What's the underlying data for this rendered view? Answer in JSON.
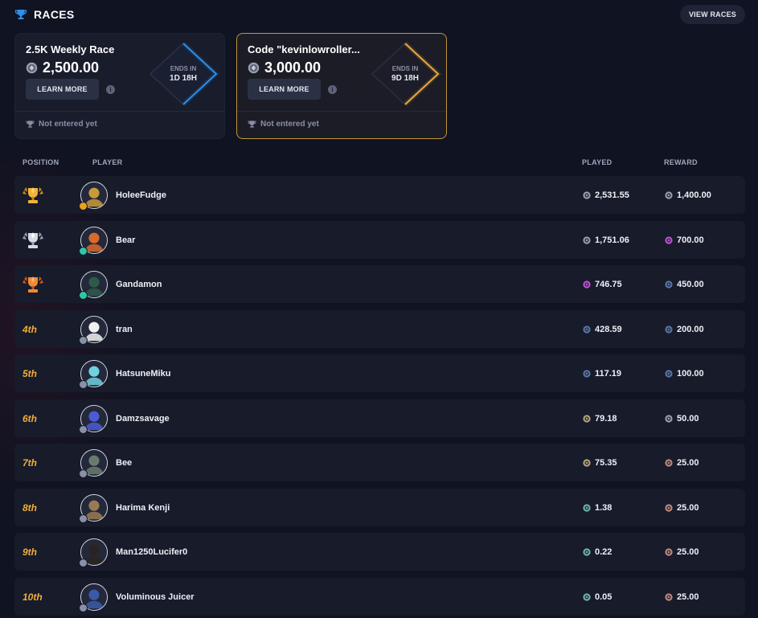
{
  "header": {
    "title": "RACES",
    "view_button": "VIEW RACES"
  },
  "races": [
    {
      "name": "2.5K Weekly Race",
      "amount": "2,500.00",
      "learn_more": "LEARN MORE",
      "ends_label": "ENDS IN",
      "ends_value": "1D 18H",
      "status": "Not entered yet",
      "accent": "#2a8fe8"
    },
    {
      "name": "Code \"kevinlowroller...",
      "amount": "3,000.00",
      "learn_more": "LEARN MORE",
      "ends_label": "ENDS IN",
      "ends_value": "9D 18H",
      "status": "Not entered yet",
      "accent": "#e9a93a"
    }
  ],
  "columns": {
    "position": "POSITION",
    "player": "PLAYER",
    "played": "PLAYED",
    "reward": "REWARD"
  },
  "leaderboard": [
    {
      "position": "",
      "trophy": "gold",
      "name": "HoleeFudge",
      "played": "2,531.55",
      "played_coin": "#9aa0ad",
      "reward": "1,400.00",
      "reward_coin": "#9aa0ad",
      "badge": "#e8a21c",
      "avatar_color": "#c99a3a"
    },
    {
      "position": "",
      "trophy": "silver",
      "name": "Bear",
      "played": "1,751.06",
      "played_coin": "#9aa0ad",
      "reward": "700.00",
      "reward_coin": "#c34fd8",
      "badge": "#2fc7a4",
      "avatar_color": "#d86a2c"
    },
    {
      "position": "",
      "trophy": "bronze",
      "name": "Gandamon",
      "played": "746.75",
      "played_coin": "#c34fd8",
      "reward": "450.00",
      "reward_coin": "#5876a8",
      "badge": "#2fc7a4",
      "avatar_color": "#2e5a4a"
    },
    {
      "position": "4th",
      "trophy": "",
      "name": "tran",
      "played": "428.59",
      "played_coin": "#5876a8",
      "reward": "200.00",
      "reward_coin": "#5876a8",
      "badge": "#8a90a6",
      "avatar_color": "#f2f2f2"
    },
    {
      "position": "5th",
      "trophy": "",
      "name": "HatsuneMiku",
      "played": "117.19",
      "played_coin": "#5876a8",
      "reward": "100.00",
      "reward_coin": "#5876a8",
      "badge": "#8a90a6",
      "avatar_color": "#6fd0e2"
    },
    {
      "position": "6th",
      "trophy": "",
      "name": "Damzsavage",
      "played": "79.18",
      "played_coin": "#b9a57a",
      "reward": "50.00",
      "reward_coin": "#9aa0ad",
      "badge": "#8a90a6",
      "avatar_color": "#4b5bd6"
    },
    {
      "position": "7th",
      "trophy": "",
      "name": "Bee",
      "played": "75.35",
      "played_coin": "#b9a57a",
      "reward": "25.00",
      "reward_coin": "#c58a7a",
      "badge": "#8a90a6",
      "avatar_color": "#6a7a70"
    },
    {
      "position": "8th",
      "trophy": "",
      "name": "Harima Kenji",
      "played": "1.38",
      "played_coin": "#6fb5a8",
      "reward": "25.00",
      "reward_coin": "#c58a7a",
      "badge": "#8a90a6",
      "avatar_color": "#9a7a52"
    },
    {
      "position": "9th",
      "trophy": "",
      "name": "Man1250Lucifer0",
      "played": "0.22",
      "played_coin": "#6fb5a8",
      "reward": "25.00",
      "reward_coin": "#c58a7a",
      "badge": "#8a90a6",
      "avatar_color": "#2a2420"
    },
    {
      "position": "10th",
      "trophy": "",
      "name": "Voluminous Juicer",
      "played": "0.05",
      "played_coin": "#6fb5a8",
      "reward": "25.00",
      "reward_coin": "#c58a7a",
      "badge": "#8a90a6",
      "avatar_color": "#3a5aa8"
    }
  ]
}
